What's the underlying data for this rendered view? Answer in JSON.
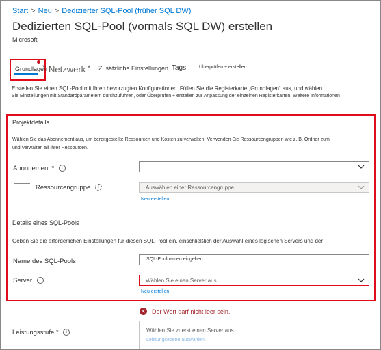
{
  "breadcrumb": {
    "items": [
      "Start",
      "Neu",
      "Dedizierter SQL-Pool (früher SQL DW)"
    ],
    "separator": ">"
  },
  "page": {
    "title": "Dedizierten SQL-Pool (vormals SQL DW) erstellen",
    "publisher": "Microsoft"
  },
  "tabs": [
    {
      "label": "Grundlagen",
      "marker": "*"
    },
    {
      "label": "Netzwerk",
      "marker": "*"
    },
    {
      "label": "Zusätzliche Einstellungen"
    },
    {
      "label": "Tags"
    },
    {
      "label": "Überprüfen + erstellen"
    }
  ],
  "intro": {
    "line1": "Erstellen Sie einen SQL-Pool mit Ihren bevorzugten Konfigurationen. Füllen Sie die Registerkarte „Grundlagen“ aus, und wählen",
    "line2": "Sie Einstellungen mit Standardparametern durchzuführen, oder Überprüfen + erstellen zur Anpassung der einzelnen Registerkarten. Weitere Informationen"
  },
  "project": {
    "heading": "Projektdetails",
    "desc1": "Wählen Sie das Abonnement aus, um bereitgestellte Ressourcen und Kosten zu verwalten. Verwenden Sie Ressourcengruppen wie z. B. Ordner zum",
    "desc2": "und Verwalten all Ihrer Ressourcen.",
    "subscription_label": "Abonnement",
    "required": "*",
    "subscription_value": "",
    "rg_label": "Ressourcengruppe",
    "rg_placeholder": "Auswählen einer Ressourcengruppe",
    "create_new": "Neu erstellen"
  },
  "pool": {
    "heading": "Details eines SQL-Pools",
    "desc": "Geben Sie die erforderlichen Einstellungen für diesen SQL-Pool ein, einschließlich der Auswahl eines logischen Servers und der",
    "name_label": "Name des SQL-Pools",
    "name_placeholder": "SQL-Poolnamen eingeben",
    "server_label": "Server",
    "server_placeholder": "Wählen Sie einen Server aus.",
    "create_new": "Neu erstellen",
    "error": "Der Wert darf nicht leer sein."
  },
  "performance": {
    "label": "Leistungsstufe",
    "required": "*",
    "hint": "Wählen Sie zuerst einen Server aus.",
    "link": "Leistungsebene auswählen"
  },
  "colors": {
    "accent": "#0078d4",
    "highlight": "#e00b1c",
    "error": "#a4262c"
  },
  "icons": [
    "info-icon",
    "chevron-down-icon",
    "error-icon",
    "refresh-icon"
  ]
}
